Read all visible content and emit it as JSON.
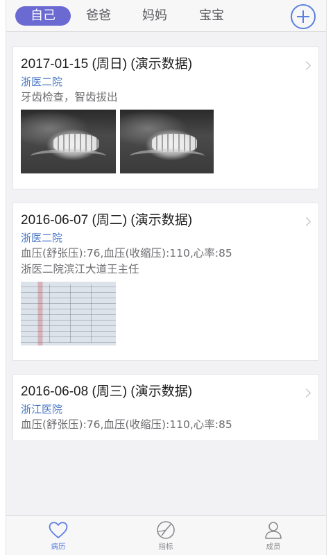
{
  "tabs": [
    {
      "label": "自己",
      "active": true
    },
    {
      "label": "爸爸",
      "active": false
    },
    {
      "label": "妈妈",
      "active": false
    },
    {
      "label": "宝宝",
      "active": false
    }
  ],
  "add_button": {
    "icon": "plus-circle-icon"
  },
  "records": [
    {
      "date": "2017-01-15 (周日) (演示数据)",
      "hospital": "浙医二院",
      "desc": [
        "牙齿检查，智齿拔出"
      ],
      "images": [
        "dental-xray",
        "dental-xray"
      ]
    },
    {
      "date": "2016-06-07 (周二) (演示数据)",
      "hospital": "浙医二院",
      "desc": [
        "血压(舒张压):76,血压(收缩压):110,心率:85",
        "浙医二院滨江大道王主任"
      ],
      "images": [
        "lab-report"
      ]
    },
    {
      "date": "2016-06-08 (周三) (演示数据)",
      "hospital": "浙江医院",
      "desc": [
        "血压(舒张压):76,血压(收缩压):110,心率:85"
      ],
      "images": []
    }
  ],
  "bottom_nav": [
    {
      "label": "病历",
      "icon": "heart-icon",
      "active": true
    },
    {
      "label": "指标",
      "icon": "chart-icon",
      "active": false
    },
    {
      "label": "成员",
      "icon": "person-icon",
      "active": false
    }
  ],
  "colors": {
    "accent": "#5b7fe0",
    "tab_active_bg": "#6a6ad2",
    "hospital_link": "#4a78c6",
    "background": "#f2f2f4"
  }
}
